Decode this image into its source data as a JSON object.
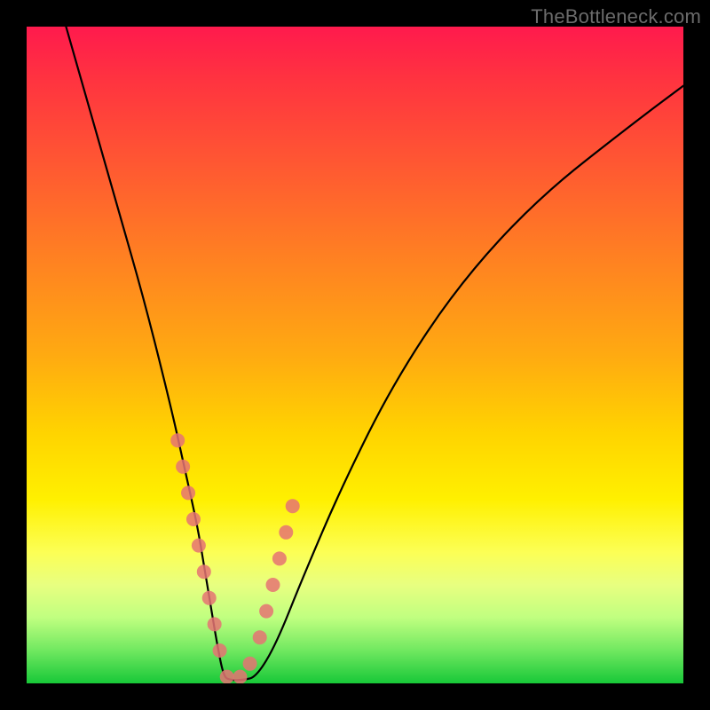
{
  "watermark": "TheBottleneck.com",
  "chart_data": {
    "type": "line",
    "title": "",
    "xlabel": "",
    "ylabel": "",
    "xlim": [
      0,
      100
    ],
    "ylim": [
      0,
      100
    ],
    "series": [
      {
        "name": "bottleneck-curve",
        "x": [
          6,
          10,
          14,
          18,
          22,
          24,
          26,
          27,
          28,
          29,
          30,
          31,
          33,
          35,
          38,
          42,
          48,
          56,
          66,
          78,
          92,
          100
        ],
        "values": [
          100,
          86,
          72,
          58,
          42,
          33,
          24,
          18,
          12,
          6,
          1,
          0.5,
          0.5,
          1,
          6,
          16,
          30,
          46,
          61,
          74,
          85,
          91
        ]
      }
    ],
    "markers": {
      "name": "highlighted-points",
      "color": "#e57373",
      "x": [
        23.0,
        23.8,
        24.6,
        25.4,
        26.2,
        27.0,
        27.8,
        28.6,
        29.4,
        30.5,
        32.5,
        34.0,
        35.5,
        36.5,
        37.5,
        38.5,
        39.5,
        40.5
      ],
      "values": [
        37,
        33,
        29,
        25,
        21,
        17,
        13,
        9,
        5,
        1,
        1,
        3,
        7,
        11,
        15,
        19,
        23,
        27
      ]
    }
  }
}
